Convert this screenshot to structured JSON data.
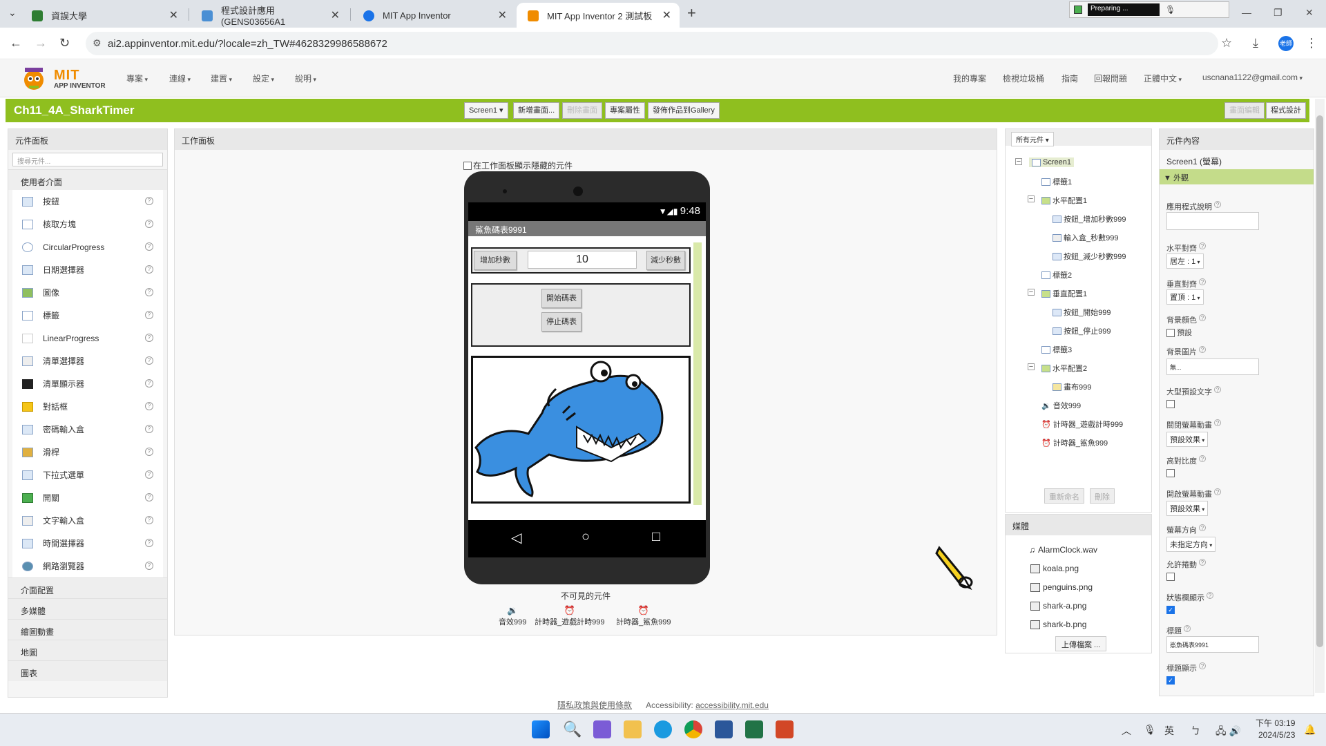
{
  "browser": {
    "tabs": [
      {
        "title": "資誤大學",
        "color": "#2e7d32"
      },
      {
        "title": "程式設計應用 (GENS03656A1",
        "color": "#4a8fd4"
      },
      {
        "title": "MIT App Inventor",
        "color": "#1a73e8"
      },
      {
        "title": "MIT App Inventor 2 測試板",
        "color": "#f08c00"
      }
    ],
    "url": "ai2.appinventor.mit.edu/?locale=zh_TW#4628329986588672",
    "recorder_label": "Preparing ...",
    "profile_label": "老師"
  },
  "app": {
    "logo_top": "MIT",
    "logo_bottom": "APP INVENTOR",
    "menus": [
      "專案",
      "連線",
      "建置",
      "設定",
      "說明"
    ],
    "right_menus": [
      "我的專案",
      "檢視垃圾桶",
      "指南",
      "回報問題",
      "正體中文",
      "uscnana1122@gmail.com"
    ]
  },
  "project": {
    "name": "Ch11_4A_SharkTimer",
    "buttons": [
      "Screen1",
      "新增畫面...",
      "刪除畫面",
      "專案屬性",
      "發佈作品到Gallery"
    ],
    "right_buttons": [
      "畫面編輯",
      "程式設計"
    ]
  },
  "palette": {
    "title": "元件面板",
    "search_placeholder": "搜尋元件...",
    "category_open": "使用者介面",
    "items": [
      "按鈕",
      "核取方塊",
      "CircularProgress",
      "日期選擇器",
      "圖像",
      "標籤",
      "LinearProgress",
      "清單選擇器",
      "清單顯示器",
      "對話框",
      "密碼輸入盒",
      "滑桿",
      "下拉式選單",
      "開關",
      "文字輸入盒",
      "時間選擇器",
      "網路瀏覽器"
    ],
    "categories": [
      "介面配置",
      "多媒體",
      "繪圖動畫",
      "地圖",
      "圖表"
    ]
  },
  "viewer": {
    "title": "工作面板",
    "hidden_checkbox": "在工作面板顯示隱藏的元件",
    "clock": "9:48",
    "screen_title": "鯊魚碼表9991",
    "btn_add": "增加秒數",
    "text_value": "10",
    "btn_sub": "減少秒數",
    "btn_start": "開始碼表",
    "btn_stop": "停止碼表",
    "nonvisible_title": "不可見的元件",
    "nonvisible": [
      "音效999",
      "計時器_遊戲計時999",
      "計時器_鯊魚999"
    ]
  },
  "tree": {
    "dropdown": "所有元件",
    "nodes": [
      {
        "label": "Screen1",
        "selected": true
      },
      {
        "label": "標籤1"
      },
      {
        "label": "水平配置1"
      },
      {
        "label": "按鈕_增加秒數999"
      },
      {
        "label": "輸入盒_秒數999"
      },
      {
        "label": "按鈕_減少秒數999"
      },
      {
        "label": "標籤2"
      },
      {
        "label": "垂直配置1"
      },
      {
        "label": "按鈕_開始999"
      },
      {
        "label": "按鈕_停止999"
      },
      {
        "label": "標籤3"
      },
      {
        "label": "水平配置2"
      },
      {
        "label": "畫布999"
      },
      {
        "label": "音效999"
      },
      {
        "label": "計時器_遊戲計時999"
      },
      {
        "label": "計時器_鯊魚999"
      }
    ],
    "rename": "重新命名",
    "delete": "刪除"
  },
  "media": {
    "title": "媒體",
    "files": [
      "AlarmClock.wav",
      "koala.png",
      "penguins.png",
      "shark-a.png",
      "shark-b.png"
    ],
    "upload": "上傳檔案 ..."
  },
  "props": {
    "title": "元件內容",
    "subject": "Screen1 (螢幕)",
    "section": "外觀",
    "about_label": "應用程式說明",
    "halign_label": "水平對齊",
    "halign_value": "居左 : 1",
    "valign_label": "垂直對齊",
    "valign_value": "置頂 : 1",
    "bgcolor_label": "背景顏色",
    "bgcolor_value": "預設",
    "bgimage_label": "背景圖片",
    "bgimage_value": "無...",
    "bigfont_label": "大型預設文字",
    "closeanim_label": "關閉螢幕動畫",
    "closeanim_value": "預設效果",
    "highcontrast_label": "高對比度",
    "openanim_label": "開啟螢幕動畫",
    "openanim_value": "預設效果",
    "orientation_label": "螢幕方向",
    "orientation_value": "未指定方向",
    "scrollable_label": "允許捲動",
    "statusbar_label": "狀態欄顯示",
    "title_label": "標題",
    "title_value": "鯊魚碼表9991",
    "titlevisible_label": "標題顯示"
  },
  "footer": {
    "privacy": "隱私政策與使用條款",
    "accessibility_label": "Accessibility:",
    "accessibility_link": "accessibility.mit.edu"
  },
  "taskbar": {
    "time": "下午 03:19",
    "date": "2024/5/23",
    "ime": "英"
  },
  "colors": {
    "accent_green": "#8fbf1f",
    "shark_blue": "#3a8fe0"
  }
}
